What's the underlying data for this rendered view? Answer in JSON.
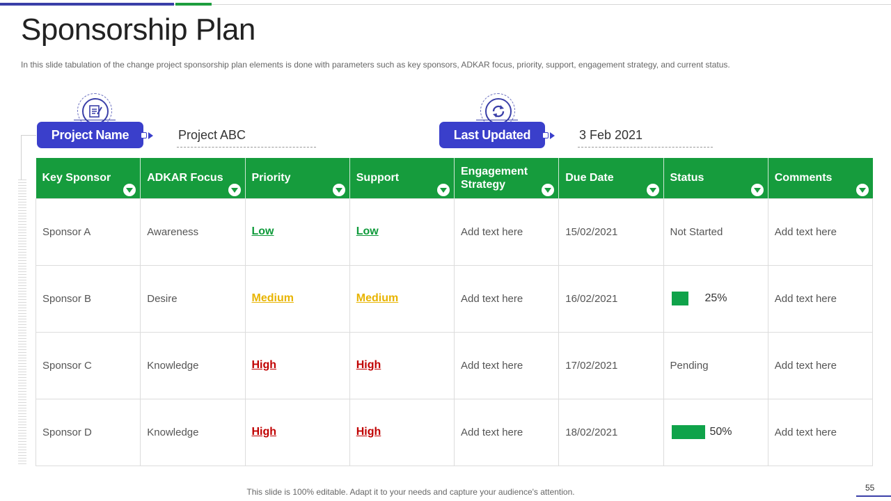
{
  "slide": {
    "title": "Sponsorship Plan",
    "subtitle": "In this slide tabulation of the change project sponsorship plan elements is done with parameters such as key sponsors, ADKAR focus, priority, support, engagement strategy, and current status.",
    "footer": "This slide is 100% editable. Adapt it to your needs and capture your audience's attention.",
    "page_number": "55"
  },
  "meta": {
    "project_name_label": "Project Name",
    "project_name_value": "Project ABC",
    "last_updated_label": "Last Updated",
    "last_updated_value": "3 Feb 2021",
    "project_icon": "checklist-icon",
    "update_icon": "refresh-icon"
  },
  "colors": {
    "header_green": "#169c3d",
    "pill_blue": "#3a3fcb",
    "low": "#0e9a3a",
    "medium": "#e8b400",
    "high": "#c00000",
    "progress": "#0fa34a"
  },
  "table": {
    "headers": [
      "Key Sponsor",
      "ADKAR Focus",
      "Priority",
      "Support",
      "Engagement Strategy",
      "Due Date",
      "Status",
      "Comments"
    ],
    "rows": [
      {
        "sponsor": "Sponsor A",
        "focus": "Awareness",
        "priority": "Low",
        "support": "Low",
        "strategy": "Add text here",
        "due": "15/02/2021",
        "status": "Not Started",
        "comments": "Add text here"
      },
      {
        "sponsor": "Sponsor B",
        "focus": "Desire",
        "priority": "Medium",
        "support": "Medium",
        "strategy": "Add text here",
        "due": "16/02/2021",
        "status": "25%",
        "status_progress": 0.25,
        "comments": "Add text here"
      },
      {
        "sponsor": "Sponsor C",
        "focus": "Knowledge",
        "priority": "High",
        "support": "High",
        "strategy": "Add text here",
        "due": "17/02/2021",
        "status": "Pending",
        "comments": "Add text here"
      },
      {
        "sponsor": "Sponsor D",
        "focus": "Knowledge",
        "priority": "High",
        "support": "High",
        "strategy": "Add text here",
        "due": "18/02/2021",
        "status": "50%",
        "status_progress": 0.5,
        "comments": "Add text here"
      }
    ]
  }
}
